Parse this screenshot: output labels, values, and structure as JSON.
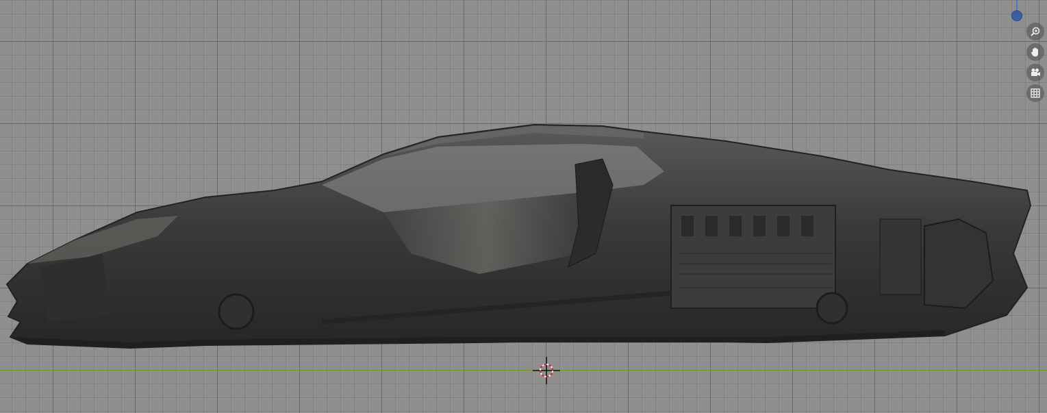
{
  "viewport": {
    "view": "side-orthographic",
    "model": "supercar-cutaway",
    "axis_colors": {
      "z": "#3a6fd8",
      "y": "#6e9a24"
    },
    "grid_color": "#8f8f8f"
  },
  "navigation_gizmo": {
    "buttons": [
      {
        "name": "zoom",
        "icon": "zoom-icon"
      },
      {
        "name": "pan",
        "icon": "hand-pan-icon"
      },
      {
        "name": "camera",
        "icon": "camera-icon"
      },
      {
        "name": "ortho-toggle",
        "icon": "grid-icon"
      }
    ]
  }
}
